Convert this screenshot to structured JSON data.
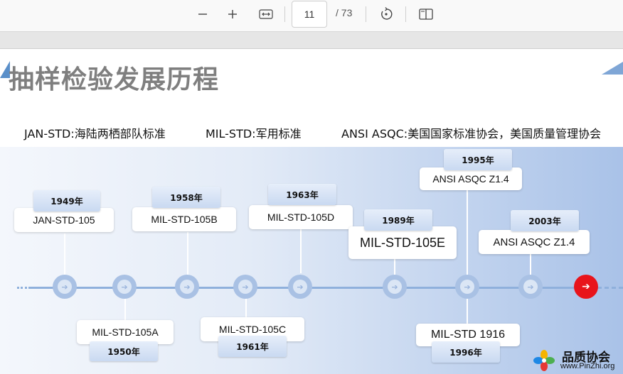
{
  "toolbar": {
    "zoom_out_icon": "minus-icon",
    "zoom_in_icon": "plus-icon",
    "fit_width_icon": "fit-width-icon",
    "current_page": "11",
    "page_total": "/ 73",
    "rotate_icon": "rotate-icon",
    "two_page_icon": "page-view-icon"
  },
  "slide": {
    "title": "抽样检验发展历程",
    "definitions": [
      "JAN-STD:海陆两栖部队标准",
      "MIL-STD:军用标准",
      "ANSI ASQC:美国国家标准协会，美国质量管理协会"
    ],
    "milestones": [
      {
        "year": "1949年",
        "standard": "JAN-STD-105"
      },
      {
        "year": "1950年",
        "standard": "MIL-STD-105A"
      },
      {
        "year": "1958年",
        "standard": "MIL-STD-105B"
      },
      {
        "year": "1961年",
        "standard": "MIL-STD-105C"
      },
      {
        "year": "1963年",
        "standard": "MIL-STD-105D"
      },
      {
        "year": "1989年",
        "standard": "MIL-STD-105E"
      },
      {
        "year": "1995年",
        "standard": "ANSI ASQC Z1.4"
      },
      {
        "year": "1996年",
        "standard": "MIL-STD 1916"
      },
      {
        "year": "2003年",
        "standard": "ANSI ASQC Z1.4"
      }
    ]
  },
  "logo": {
    "name": "品质协会",
    "url": "www.PinZhi.org"
  },
  "colors": {
    "accent_red": "#e8141b",
    "timeline_blue": "#8fb0dc",
    "title_gray": "#7f7f7f"
  }
}
